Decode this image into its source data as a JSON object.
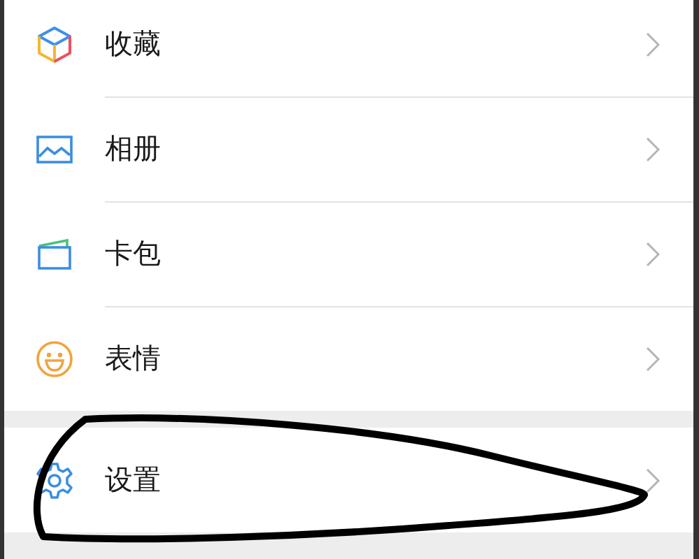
{
  "groups": [
    {
      "items": [
        {
          "kind": "cube",
          "label": "收藏",
          "circled": false
        },
        {
          "kind": "photo",
          "label": "相册",
          "circled": false
        },
        {
          "kind": "card",
          "label": "卡包",
          "circled": false
        },
        {
          "kind": "smile",
          "label": "表情",
          "circled": false
        }
      ]
    },
    {
      "items": [
        {
          "kind": "gear",
          "label": "设置",
          "circled": true
        }
      ]
    }
  ]
}
